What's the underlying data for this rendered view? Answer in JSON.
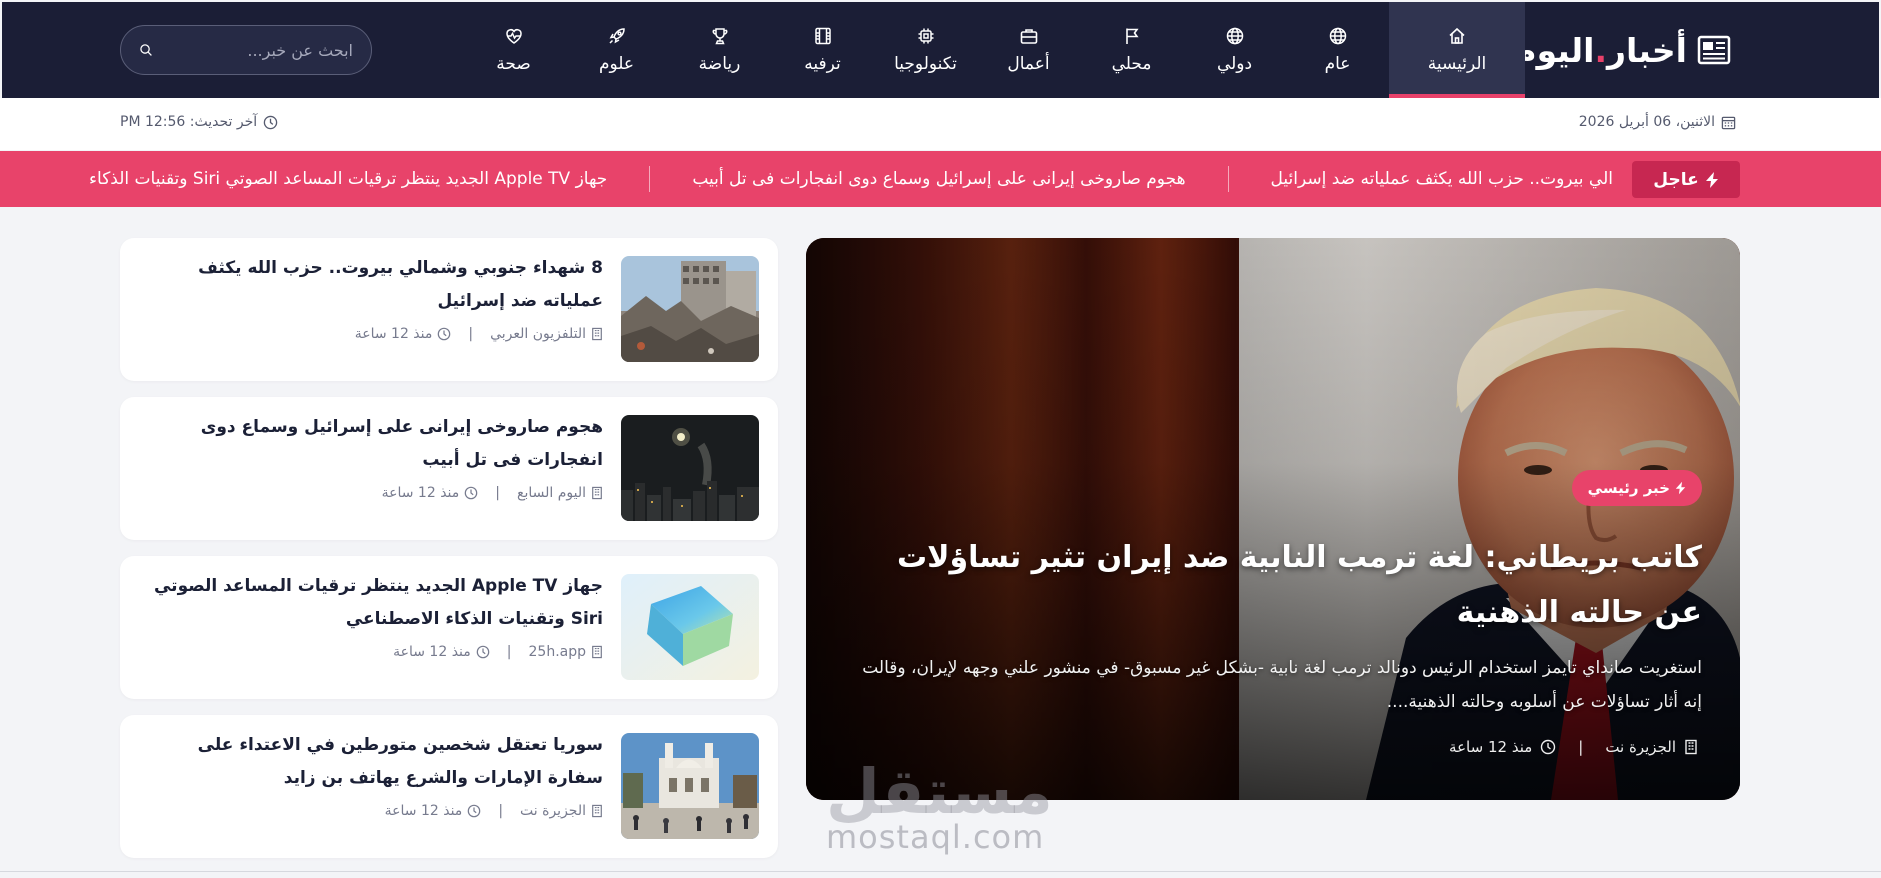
{
  "brand": {
    "name_main": "أخبار",
    "name_accent": "اليوم",
    "icon": "newspaper-icon"
  },
  "nav": {
    "items": [
      {
        "label": "الرئيسية",
        "icon": "home-icon",
        "active": true
      },
      {
        "label": "عام",
        "icon": "globe-icon"
      },
      {
        "label": "دولي",
        "icon": "globe-icon"
      },
      {
        "label": "محلي",
        "icon": "flag-icon"
      },
      {
        "label": "أعمال",
        "icon": "briefcase-icon"
      },
      {
        "label": "تكنولوجيا",
        "icon": "chip-icon"
      },
      {
        "label": "ترفيه",
        "icon": "film-icon"
      },
      {
        "label": "رياضة",
        "icon": "trophy-icon"
      },
      {
        "label": "علوم",
        "icon": "rocket-icon"
      },
      {
        "label": "صحة",
        "icon": "heart-pulse-icon"
      }
    ]
  },
  "search": {
    "placeholder": "ابحث عن خبر..."
  },
  "infobar": {
    "date": "الاثنين، 06 أبريل 2026",
    "updated": "آخر تحديث: 12:56 PM"
  },
  "ticker": {
    "badge": "عاجل",
    "items": [
      "الي بيروت.. حزب الله يكثف عملياته ضد إسرائيل",
      "هجوم صاروخى إيرانى على إسرائيل وسماع دوى انفجارات فى تل أبيب",
      "جهاز Apple TV الجديد ينتظر ترقيات المساعد الصوتي Siri وتقنيات الذكاء"
    ]
  },
  "hero": {
    "tag": "خبر رئيسي",
    "title": "كاتب بريطاني: لغة ترمب النابية ضد إيران تثير تساؤلات عن حالته الذهنية",
    "summary": "استغريت صانداي تايمز استخدام الرئيس دونالد ترمب لغة نابية -بشكل غير مسبوق- في منشور علني وجهه لإيران، وقالت إنه أثار تساؤلات عن أسلوبه وحالته الذهنية....",
    "source": "الجزيرة نت",
    "time": "منذ 12 ساعة"
  },
  "side": [
    {
      "title": "8 شهداء جنوبي وشمالي بيروت.. حزب الله يكثف عملياته ضد إسرائيل",
      "source": "التلفزيون العربي",
      "time": "منذ 12 ساعة"
    },
    {
      "title": "هجوم صاروخى إيرانى على إسرائيل وسماع دوى انفجارات فى تل أبيب",
      "source": "اليوم السابع",
      "time": "منذ 12 ساعة"
    },
    {
      "title": "جهاز Apple TV الجديد ينتظر ترقيات المساعد الصوتي Siri وتقنيات الذكاء الاصطناعي",
      "source": "25h.app",
      "time": "منذ 12 ساعة"
    },
    {
      "title": "سوريا تعتقل شخصين متورطين في الاعتداء على سفارة الإمارات والشرع يهاتف بن زايد",
      "source": "الجزيرة نت",
      "time": "منذ 12 ساعة"
    }
  ],
  "watermark": {
    "arabic": "مستقل",
    "latin": "mostaql.com"
  },
  "colors": {
    "nav_bg": "#1b1e36",
    "accent": "#e8436a",
    "badge": "#c72751"
  }
}
